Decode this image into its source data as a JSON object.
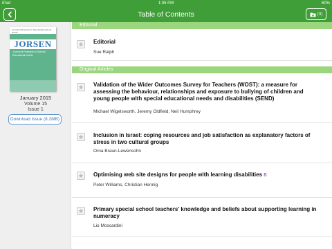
{
  "status_bar": {
    "carrier": "iPad",
    "time": "1:05 PM",
    "battery": "60%"
  },
  "nav": {
    "title": "Table of Contents",
    "download_count": "(0)"
  },
  "issue": {
    "cover": {
      "top_text": "Journal of Research in Special Educational Needs",
      "title": "JORSEN",
      "subtitle": "Journal of Research in Special Educational Needs"
    },
    "date": "January 2015",
    "volume": "Volume 15",
    "issue": "Issue 1",
    "download_label": "Download Issue (8.2MB)"
  },
  "sections": [
    {
      "name": "Editorial",
      "articles": [
        {
          "title": "Editorial",
          "authors": "Sue Ralph"
        }
      ]
    },
    {
      "name": "Original Articles",
      "articles": [
        {
          "title": "Validation of the Wider Outcomes Survey for Teachers (WOST): a measure for assessing the behaviour, relationships and exposure to bullying of children and young people with special educational needs and disabilities (SEND)",
          "authors": "Michael Wigelsworth, Jeremy Oldfield, Neil Humphrey"
        },
        {
          "title": "Inclusion in Israel: coping resources and job satisfaction as explanatory factors of stress in two cultural groups",
          "authors": "Orna Braun-Lewensohn"
        },
        {
          "title": "Optimising web site designs for people with learning disabilities",
          "authors": "Peter Williams, Christian Hennig",
          "open_access_icon": "open-lock-icon"
        },
        {
          "title": "Primary special school teachers' knowledge and beliefs about supporting learning in numeracy",
          "authors": "Lio Moscardini"
        }
      ]
    }
  ],
  "colors": {
    "header_green": "#3f9e38",
    "section_green": "#9bd67f",
    "link_blue": "#3b79bc"
  }
}
